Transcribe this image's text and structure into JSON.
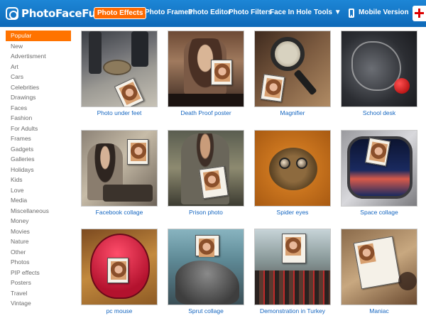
{
  "brand": {
    "name": "PhotoFaceFun"
  },
  "nav": {
    "items": [
      {
        "label": "Photo Effects",
        "active": true
      },
      {
        "label": "Photo Frames",
        "active": false
      },
      {
        "label": "Photo Editor",
        "active": false
      },
      {
        "label": "Photo Filters",
        "active": false
      },
      {
        "label": "Face In Hole",
        "active": false
      },
      {
        "label": "Tools ▼",
        "active": false
      },
      {
        "label": "Mobile Version",
        "active": false
      }
    ]
  },
  "categories": [
    {
      "label": "Popular",
      "active": true
    },
    {
      "label": "New"
    },
    {
      "label": "Advertisment"
    },
    {
      "label": "Art"
    },
    {
      "label": "Cars"
    },
    {
      "label": "Celebrities"
    },
    {
      "label": "Drawings"
    },
    {
      "label": "Faces"
    },
    {
      "label": "Fashion"
    },
    {
      "label": "For Adults"
    },
    {
      "label": "Frames"
    },
    {
      "label": "Gadgets"
    },
    {
      "label": "Galleries"
    },
    {
      "label": "Holidays"
    },
    {
      "label": "Kids"
    },
    {
      "label": "Love"
    },
    {
      "label": "Media"
    },
    {
      "label": "Miscellaneous"
    },
    {
      "label": "Money"
    },
    {
      "label": "Movies"
    },
    {
      "label": "Nature"
    },
    {
      "label": "Other"
    },
    {
      "label": "Photos"
    },
    {
      "label": "PIP effects"
    },
    {
      "label": "Posters"
    },
    {
      "label": "Travel"
    },
    {
      "label": "Vintage"
    }
  ],
  "effects": [
    {
      "caption": "Photo under feet",
      "scene": "feet"
    },
    {
      "caption": "Death Proof poster",
      "scene": "poster"
    },
    {
      "caption": "Magnifier",
      "scene": "magnifier"
    },
    {
      "caption": "School desk",
      "scene": "desk"
    },
    {
      "caption": "Facebook collage",
      "scene": "facebook"
    },
    {
      "caption": "Prison photo",
      "scene": "prison"
    },
    {
      "caption": "Spider eyes",
      "scene": "spider"
    },
    {
      "caption": "Space collage",
      "scene": "space"
    },
    {
      "caption": "pc mouse",
      "scene": "mouse"
    },
    {
      "caption": "Sprut collage",
      "scene": "sprut"
    },
    {
      "caption": "Demonstration in Turkey",
      "scene": "demo"
    },
    {
      "caption": "Maniac",
      "scene": "maniac"
    }
  ],
  "colors": {
    "header": "#1178c8",
    "accent": "#ff7300",
    "link": "#1566c0",
    "sidebar_text": "#6b6b6b"
  },
  "icons": {
    "phone": "mobile-phone-icon",
    "flag": "england-flag-icon"
  }
}
